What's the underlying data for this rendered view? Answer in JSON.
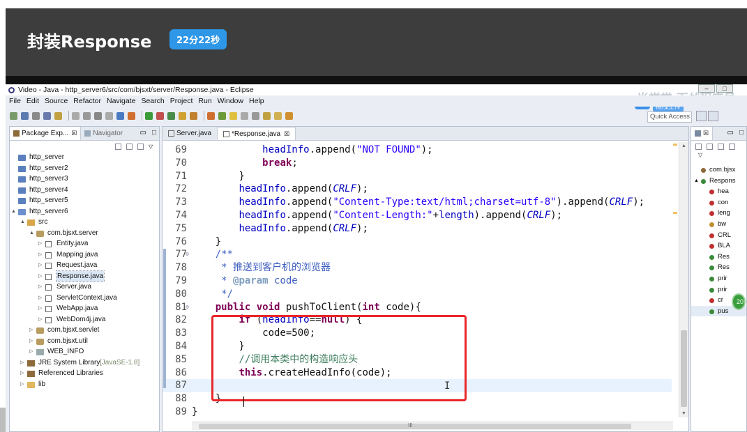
{
  "video": {
    "title": "封装Response",
    "time_badge": "22分22秒",
    "watermark_text": "尚学堂·百战程序员",
    "watermark_button": "拖拽上传"
  },
  "window": {
    "title": "Video - Java - http_server6/src/com/bjsxt/server/Response.java - Eclipse"
  },
  "menu": [
    "File",
    "Edit",
    "Source",
    "Refactor",
    "Navigate",
    "Search",
    "Project",
    "Run",
    "Window",
    "Help"
  ],
  "toolbar": {
    "quick_access": "Quick Access"
  },
  "package_explorer": {
    "tabs": [
      "Package Exp...",
      "Navigator"
    ],
    "items": [
      {
        "label": "http_server",
        "indent": 0,
        "icon": "project-icon",
        "arrow": ""
      },
      {
        "label": "http_server2",
        "indent": 0,
        "icon": "project-icon",
        "arrow": ""
      },
      {
        "label": "http_server3",
        "indent": 0,
        "icon": "project-icon",
        "arrow": ""
      },
      {
        "label": "http_server4",
        "indent": 0,
        "icon": "project-icon",
        "arrow": ""
      },
      {
        "label": "http_server5",
        "indent": 0,
        "icon": "project-icon",
        "arrow": ""
      },
      {
        "label": "http_server6",
        "indent": 0,
        "icon": "java-project-icon",
        "arrow": "▲"
      },
      {
        "label": "src",
        "indent": 1,
        "icon": "source-folder-icon",
        "arrow": "▲"
      },
      {
        "label": "com.bjsxt.server",
        "indent": 2,
        "icon": "package-icon",
        "arrow": "▲"
      },
      {
        "label": "Entity.java",
        "indent": 3,
        "icon": "java-file-icon",
        "arrow": "▷"
      },
      {
        "label": "Mapping.java",
        "indent": 3,
        "icon": "java-file-icon",
        "arrow": "▷"
      },
      {
        "label": "Request.java",
        "indent": 3,
        "icon": "java-file-icon",
        "arrow": "▷"
      },
      {
        "label": "Response.java",
        "indent": 3,
        "icon": "java-file-icon",
        "arrow": "▷",
        "selected": true
      },
      {
        "label": "Server.java",
        "indent": 3,
        "icon": "java-file-icon",
        "arrow": "▷"
      },
      {
        "label": "ServletContext.java",
        "indent": 3,
        "icon": "java-file-icon",
        "arrow": "▷"
      },
      {
        "label": "WebApp.java",
        "indent": 3,
        "icon": "java-file-icon",
        "arrow": "▷"
      },
      {
        "label": "WebDom4j.java",
        "indent": 3,
        "icon": "java-file-icon",
        "arrow": "▷"
      },
      {
        "label": "com.bjsxt.servlet",
        "indent": 2,
        "icon": "package-icon",
        "arrow": "▷"
      },
      {
        "label": "com.bjsxt.util",
        "indent": 2,
        "icon": "package-icon",
        "arrow": "▷"
      },
      {
        "label": "WEB_INFO",
        "indent": 2,
        "icon": "folder-icon",
        "arrow": "▷"
      },
      {
        "label": "JRE System Library",
        "extra": "[JavaSE-1.8]",
        "indent": 1,
        "icon": "library-icon",
        "arrow": "▷"
      },
      {
        "label": "Referenced Libraries",
        "indent": 1,
        "icon": "library-icon",
        "arrow": "▷"
      },
      {
        "label": "lib",
        "indent": 1,
        "icon": "open-folder-icon",
        "arrow": "▷"
      }
    ]
  },
  "editor": {
    "tabs": [
      {
        "label": "Server.java",
        "active": false
      },
      {
        "label": "*Response.java",
        "active": true
      }
    ],
    "lines": [
      {
        "n": "69",
        "ann": "",
        "html": "            <span class='fld'>headInfo</span>.append(<span class='str'>\"NOT FOUND\"</span>);"
      },
      {
        "n": "70",
        "ann": "",
        "html": "            <span class='kw'>break</span>;"
      },
      {
        "n": "71",
        "ann": "",
        "html": "        }"
      },
      {
        "n": "72",
        "ann": "",
        "html": "        <span class='fld'>headInfo</span>.append(<span class='stat'>CRLF</span>);"
      },
      {
        "n": "73",
        "ann": "",
        "html": "        <span class='fld'>headInfo</span>.append(<span class='str'>\"Content-Type:text/html;charset=utf-8\"</span>).append(<span class='stat'>CRLF</span>);"
      },
      {
        "n": "74",
        "ann": "",
        "html": "        <span class='fld'>headInfo</span>.append(<span class='str'>\"Content-Length:\"</span>+<span class='fld'>length</span>).append(<span class='stat'>CRLF</span>);"
      },
      {
        "n": "75",
        "ann": "",
        "html": "        <span class='fld'>headInfo</span>.append(<span class='stat'>CRLF</span>);"
      },
      {
        "n": "76",
        "ann": "",
        "html": "    }"
      },
      {
        "n": "77",
        "ann": "⊖",
        "html": "    <span class='jdoc'>/**</span>"
      },
      {
        "n": "78",
        "ann": "",
        "html": "<span class='jdoc'>     * 推送到客户机的浏览器</span>"
      },
      {
        "n": "79",
        "ann": "",
        "html": "<span class='jdoc'>     * </span><span class='jtag'>@param</span><span class='jdoc'> code</span>"
      },
      {
        "n": "80",
        "ann": "",
        "html": "<span class='jdoc'>     */</span>"
      },
      {
        "n": "81",
        "ann": "⊖",
        "html": "    <span class='kw'>public</span> <span class='kw'>void</span> pushToClient(<span class='kw'>int</span> code){"
      },
      {
        "n": "82",
        "ann": "",
        "html": "        <span class='kw'>if</span> (<span class='fld'>headInfo</span>==<span class='kw'>null</span>) {"
      },
      {
        "n": "83",
        "ann": "",
        "html": "            code=500;"
      },
      {
        "n": "84",
        "ann": "",
        "html": "        }"
      },
      {
        "n": "85",
        "ann": "",
        "html": "        <span class='cmt'>//调用本类中的构造响应头</span>"
      },
      {
        "n": "86",
        "ann": "",
        "html": "        <span class='kw'>this</span>.createHeadInfo(code);"
      },
      {
        "n": "87",
        "ann": "",
        "html": "        ",
        "current": true
      },
      {
        "n": "88",
        "ann": "",
        "html": "    }"
      },
      {
        "n": "89",
        "ann": "",
        "html": "}"
      }
    ]
  },
  "outline": {
    "items": [
      {
        "label": "com.bjsx",
        "icon": "import-icon",
        "color": "#8a6a3a",
        "indent": 0
      },
      {
        "label": "Respons",
        "icon": "class-icon",
        "color": "#3a8a3a",
        "indent": 0,
        "arrow": "▲"
      },
      {
        "label": "hea",
        "icon": "private-field-icon",
        "color": "#c03030",
        "indent": 1
      },
      {
        "label": "con",
        "icon": "private-field-icon",
        "color": "#c03030",
        "indent": 1
      },
      {
        "label": "leng",
        "icon": "private-field-icon",
        "color": "#c03030",
        "indent": 1
      },
      {
        "label": "bw",
        "icon": "field-icon",
        "color": "#c09030",
        "indent": 1
      },
      {
        "label": "CRL",
        "icon": "static-final-icon",
        "color": "#c03030",
        "indent": 1
      },
      {
        "label": "BLA",
        "icon": "static-final-icon",
        "color": "#c03030",
        "indent": 1
      },
      {
        "label": "Res",
        "icon": "constructor-icon",
        "color": "#3a8a3a",
        "indent": 1
      },
      {
        "label": "Res",
        "icon": "constructor-icon",
        "color": "#3a8a3a",
        "indent": 1
      },
      {
        "label": "prir",
        "icon": "method-icon",
        "color": "#3a8a3a",
        "indent": 1
      },
      {
        "label": "prir",
        "icon": "method-icon",
        "color": "#3a8a3a",
        "indent": 1
      },
      {
        "label": "cr",
        "icon": "private-method-icon",
        "color": "#c03030",
        "indent": 1
      },
      {
        "label": "pus",
        "icon": "method-icon",
        "color": "#3a8a3a",
        "indent": 1,
        "selected": true
      }
    ]
  },
  "green_badge": "20",
  "colors": {
    "header_bg": "#3d3d3d",
    "badge_bg": "#2e97e8",
    "highlight_border": "#e8262a",
    "keyword": "#7f0055",
    "field": "#0000c0",
    "string": "#2a00ff"
  }
}
